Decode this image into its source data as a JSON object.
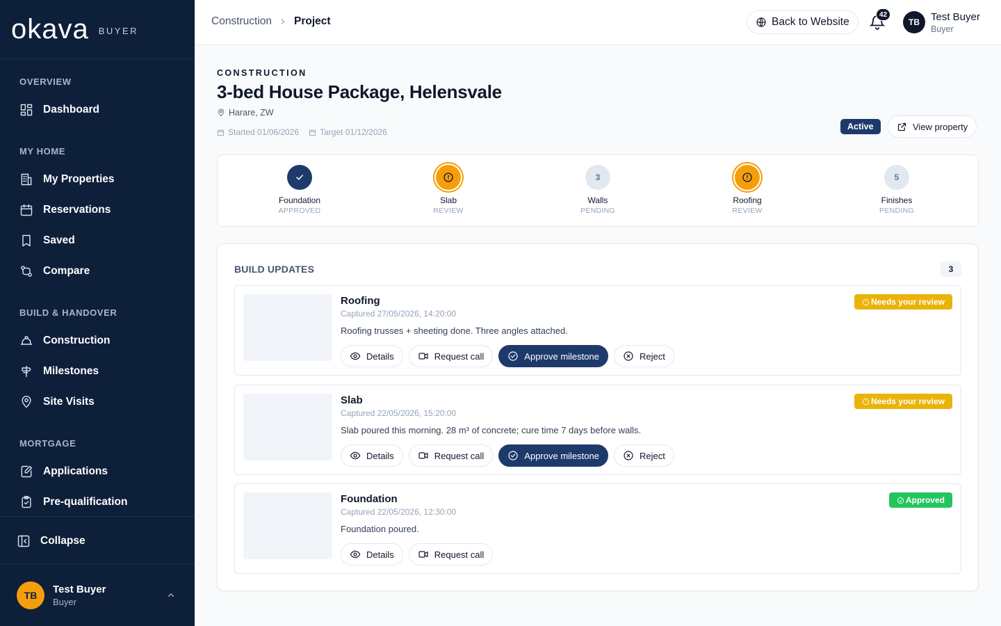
{
  "sidebar": {
    "logo": "okava",
    "logo_sub": "BUYER",
    "sections": [
      {
        "title": "OVERVIEW"
      },
      {
        "title": "MY HOME"
      },
      {
        "title": "BUILD & HANDOVER"
      },
      {
        "title": "MORTGAGE"
      }
    ],
    "items": [
      {
        "label": "Dashboard",
        "icon": "dashboard-icon"
      },
      {
        "label": "My Properties",
        "icon": "building-icon"
      },
      {
        "label": "Reservations",
        "icon": "calendar-icon"
      },
      {
        "label": "Saved",
        "icon": "bookmark-icon"
      },
      {
        "label": "Compare",
        "icon": "compare-icon"
      },
      {
        "label": "Construction",
        "icon": "hardhat-icon"
      },
      {
        "label": "Milestones",
        "icon": "signpost-icon"
      },
      {
        "label": "Site Visits",
        "icon": "map-pin-icon"
      },
      {
        "label": "Applications",
        "icon": "file-edit-icon"
      },
      {
        "label": "Pre-qualification",
        "icon": "clipboard-check-icon"
      }
    ],
    "collapse_label": "Collapse",
    "user": {
      "initials": "TB",
      "name": "Test Buyer",
      "role": "Buyer"
    }
  },
  "topbar": {
    "breadcrumb": [
      "Construction",
      "Project"
    ],
    "back_label": "Back to Website",
    "notifications": "42",
    "user": {
      "initials": "TB",
      "name": "Test Buyer",
      "role": "Buyer"
    }
  },
  "project": {
    "eyebrow": "CONSTRUCTION",
    "title": "3-bed House Package, Helensvale",
    "location": "Harare, ZW",
    "started": "Started 01/06/2026",
    "target": "Target 01/12/2026",
    "status": "Active",
    "view_label": "View property"
  },
  "steps": [
    {
      "name": "Foundation",
      "status": "APPROVED",
      "state": "done",
      "num": ""
    },
    {
      "name": "Slab",
      "status": "REVIEW",
      "state": "review",
      "num": ""
    },
    {
      "name": "Walls",
      "status": "PENDING",
      "state": "pending",
      "num": "3"
    },
    {
      "name": "Roofing",
      "status": "REVIEW",
      "state": "review",
      "num": ""
    },
    {
      "name": "Finishes",
      "status": "PENDING",
      "state": "pending",
      "num": "5"
    }
  ],
  "updates": {
    "title": "BUILD UPDATES",
    "count": "3",
    "labels": {
      "details": "Details",
      "call": "Request call",
      "approve": "Approve milestone",
      "reject": "Reject"
    },
    "items": [
      {
        "title": "Roofing",
        "captured": "Captured 27/05/2026, 14:20:00",
        "desc": "Roofing trusses + sheeting done. Three angles attached.",
        "badge": "Needs your review",
        "badge_type": "review"
      },
      {
        "title": "Slab",
        "captured": "Captured 22/05/2026, 15:20:00",
        "desc": "Slab poured this morning. 28 m³ of concrete; cure time 7 days before walls.",
        "badge": "Needs your review",
        "badge_type": "review"
      },
      {
        "title": "Foundation",
        "captured": "Captured 22/05/2026, 12:30:00",
        "desc": "Foundation poured.",
        "badge": "Approved",
        "badge_type": "approved"
      }
    ]
  },
  "colors": {
    "sidebar": "#0e1f3a",
    "primary": "#1e3a6b",
    "review": "#f59e0b",
    "approved": "#22c55e"
  }
}
